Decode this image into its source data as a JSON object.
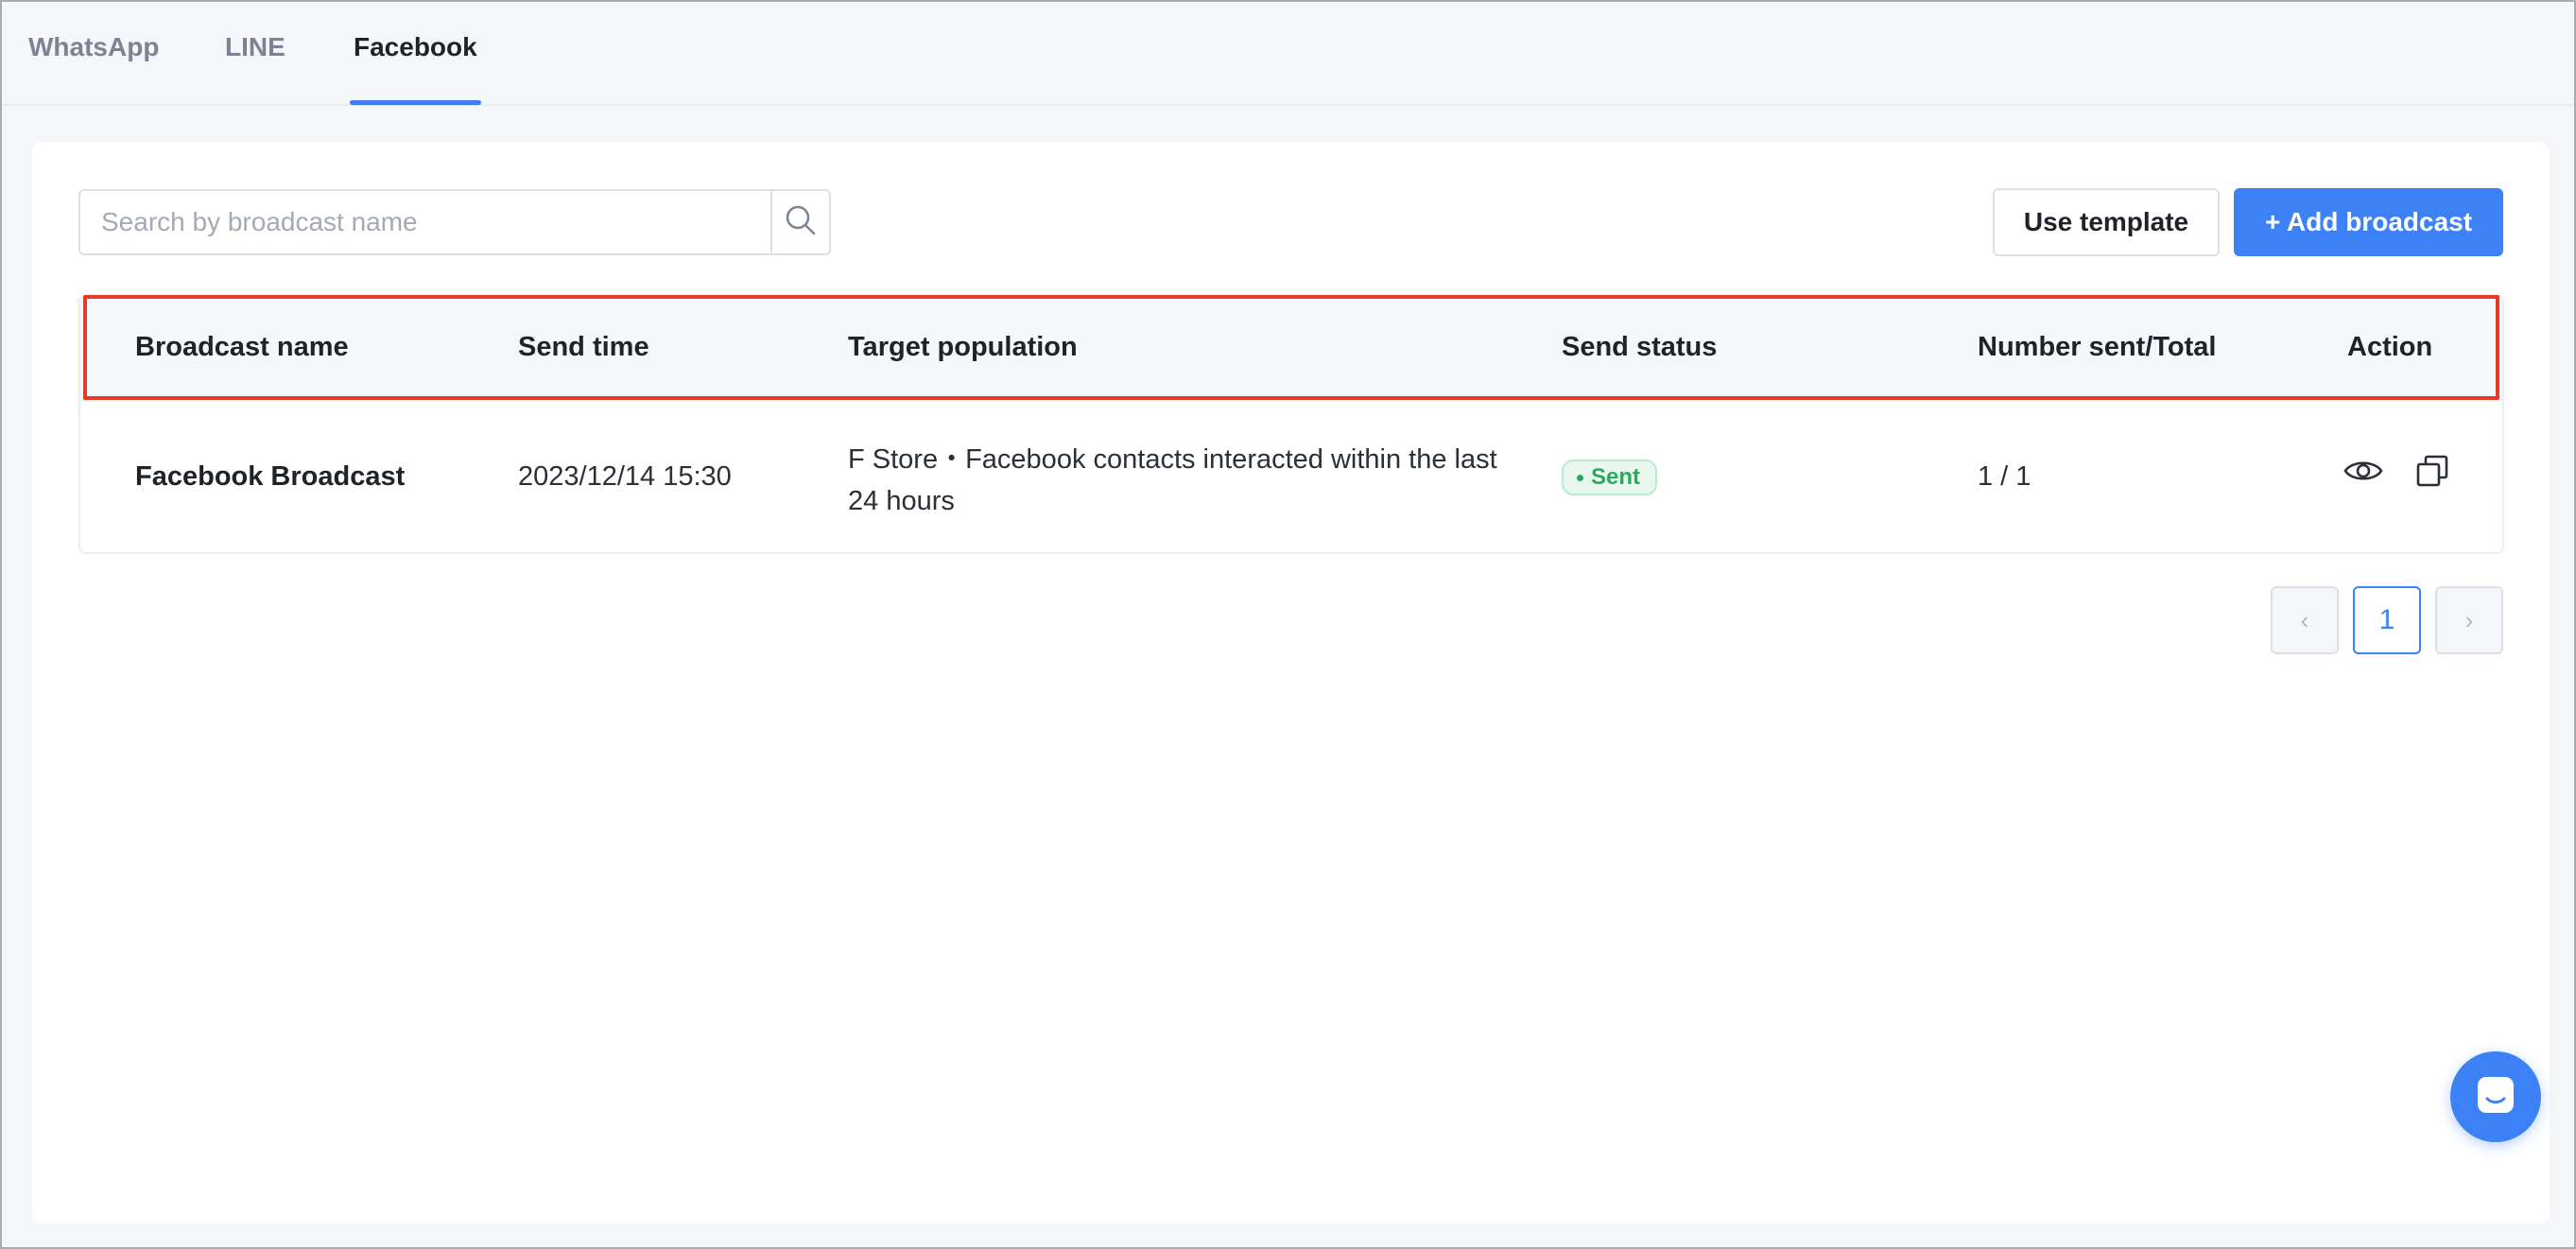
{
  "tabs": [
    {
      "label": "WhatsApp"
    },
    {
      "label": "LINE"
    },
    {
      "label": "Facebook"
    }
  ],
  "active_tab": "Facebook",
  "search": {
    "placeholder": "Search by broadcast name",
    "value": ""
  },
  "buttons": {
    "use_template": "Use template",
    "add_broadcast": "+ Add broadcast"
  },
  "table": {
    "columns": [
      "Broadcast name",
      "Send time",
      "Target population",
      "Send status",
      "Number sent/Total",
      "Action"
    ],
    "rows": [
      {
        "name": "Facebook Broadcast",
        "send_time": "2023/12/14 15:30",
        "target": "F Store・Facebook contacts interacted within the last 24 hours",
        "status": "Sent",
        "count": "1 / 1"
      }
    ]
  },
  "pagination": {
    "prev": "‹",
    "current": "1",
    "next": "›"
  },
  "icons": {
    "search": "search-icon",
    "view": "eye-icon",
    "copy": "copy-icon",
    "chat": "chat-icon"
  },
  "colors": {
    "accent": "#3c82f6",
    "highlight": "#e53a27",
    "status_sent": "#2ca860"
  }
}
